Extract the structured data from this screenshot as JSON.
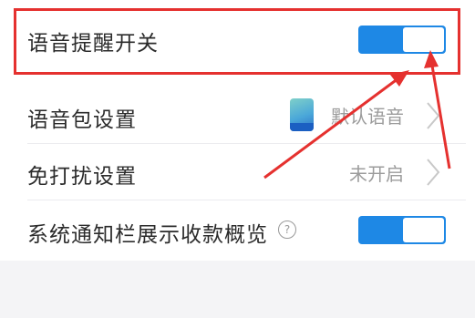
{
  "settings": {
    "voice_reminder": {
      "label": "语音提醒开关",
      "enabled": true
    },
    "voice_pack": {
      "label": "语音包设置",
      "value": "默认语音"
    },
    "do_not_disturb": {
      "label": "免打扰设置",
      "value": "未开启"
    },
    "notification_summary": {
      "label": "系统通知栏展示收款概览",
      "help_icon_text": "?",
      "enabled": true
    }
  },
  "colors": {
    "toggle_on": "#1e88e5",
    "annotation_red": "#e5312f"
  }
}
